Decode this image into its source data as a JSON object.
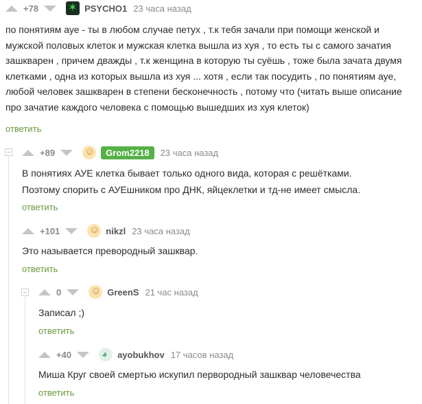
{
  "comments": [
    {
      "score": "+78",
      "user": "PSYCHO1",
      "time": "23 часа назад",
      "text": "по понятиям ауе - ты в любом случае петух , т.к тебя зачали при помощи женской и\nмужской половых клеток и мужская клетка вышла из хуя , то есть ты с самого зачатия\nзашкварен , причем дважды , т.к женщина в которую ты суёшь , тоже была зачата двумя\nклетками , одна из которых вышла из хуя ... хотя , если так посудить , по понятиям ауе,\nлюбой человек зашкварен в степени бесконечность , потому что (читать выше описание\nпро зачатие каждого человека с помощью вышедших из хуя клеток)",
      "reply": "ответить"
    },
    {
      "score": "+89",
      "user": "Grom2218",
      "time": "23 часа назад",
      "text": "В понятиях АУЕ клетка бывает только одного вида, которая с решётками.\nПоэтому спорить с АУЕшником про ДНК, яйцеклетки и тд-не имеет смысла.",
      "reply": "ответить"
    },
    {
      "score": "+101",
      "user": "nikzl",
      "time": "23 часа назад",
      "text": "Это называется превородный зашквар.",
      "reply": "ответить"
    },
    {
      "score": "0",
      "user": "GreenS",
      "time": "21 час назад",
      "text": "Записал ;)",
      "reply": "ответить"
    },
    {
      "score": "+40",
      "user": "ayobukhov",
      "time": "17 часов назад",
      "text": "Миша Круг своей смертью искупил первородный зашквар человечества",
      "reply": "ответить"
    }
  ]
}
